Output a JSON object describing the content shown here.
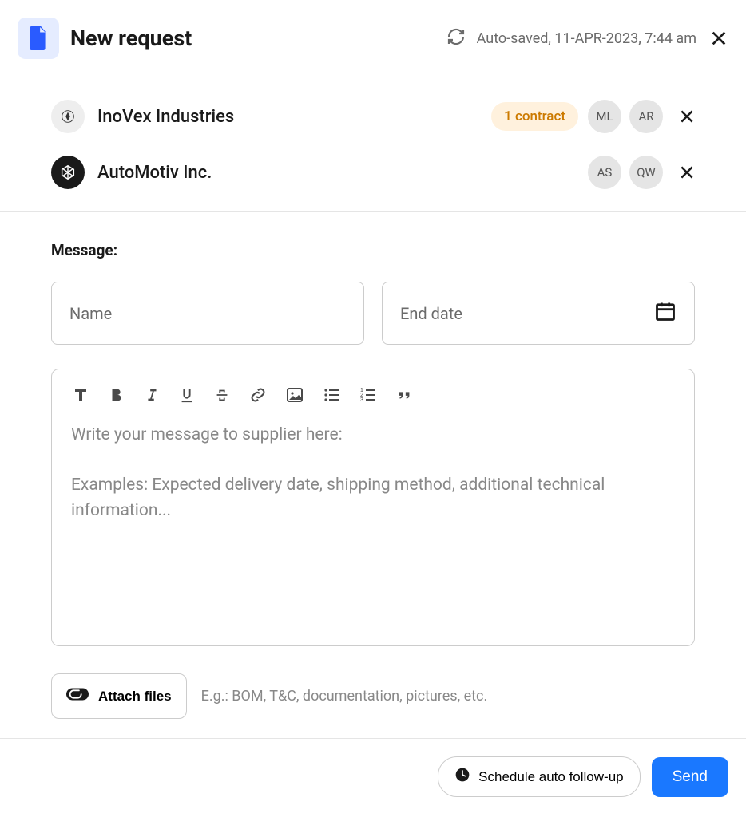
{
  "header": {
    "title": "New request",
    "autosave": "Auto-saved, 11-APR-2023, 7:44 am"
  },
  "recipients": [
    {
      "name": "InoVex Industries",
      "logo_style": "light",
      "contract_badge": "1 contract",
      "avatars": [
        "ML",
        "AR"
      ]
    },
    {
      "name": "AutoMotiv Inc.",
      "logo_style": "dark",
      "contract_badge": null,
      "avatars": [
        "AS",
        "QW"
      ]
    }
  ],
  "message": {
    "label": "Message:",
    "name_placeholder": "Name",
    "end_date_placeholder": "End date",
    "editor_placeholder_line1": "Write your message to supplier here:",
    "editor_placeholder_line2": "Examples: Expected delivery date, shipping method, additional technical information...",
    "attach_label": "Attach files",
    "attach_hint": "E.g.: BOM, T&C, documentation, pictures, etc."
  },
  "footer": {
    "schedule_label": "Schedule auto follow-up",
    "send_label": "Send"
  }
}
